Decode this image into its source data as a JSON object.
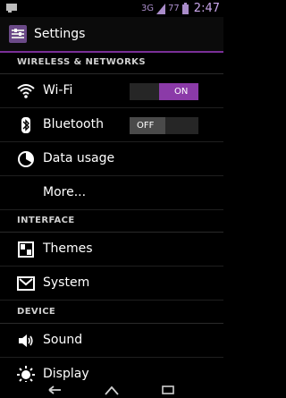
{
  "status_bar": {
    "network": "3G",
    "battery": "77",
    "time": "2:47"
  },
  "app_bar": {
    "title": "Settings"
  },
  "sections": [
    {
      "title": "WIRELESS & NETWORKS"
    },
    {
      "title": "INTERFACE"
    },
    {
      "title": "DEVICE"
    }
  ],
  "items": {
    "wifi": {
      "label": "Wi-Fi",
      "toggle": "ON"
    },
    "bluetooth": {
      "label": "Bluetooth",
      "toggle": "OFF"
    },
    "data_usage": {
      "label": "Data usage"
    },
    "more": {
      "label": "More..."
    },
    "themes": {
      "label": "Themes"
    },
    "system": {
      "label": "System"
    },
    "sound": {
      "label": "Sound"
    },
    "display": {
      "label": "Display"
    }
  },
  "icons": {
    "status_left": "notification-icon",
    "app": "settings-app-icon",
    "wifi": "wifi-icon",
    "bluetooth": "bluetooth-icon",
    "data_usage": "data-usage-icon",
    "themes": "themes-icon",
    "system": "system-icon",
    "sound": "sound-icon",
    "display": "display-icon",
    "back": "back-icon",
    "home": "home-icon",
    "recents": "recents-icon"
  },
  "colors": {
    "accent": "#8b3aa8",
    "background": "#000000"
  }
}
